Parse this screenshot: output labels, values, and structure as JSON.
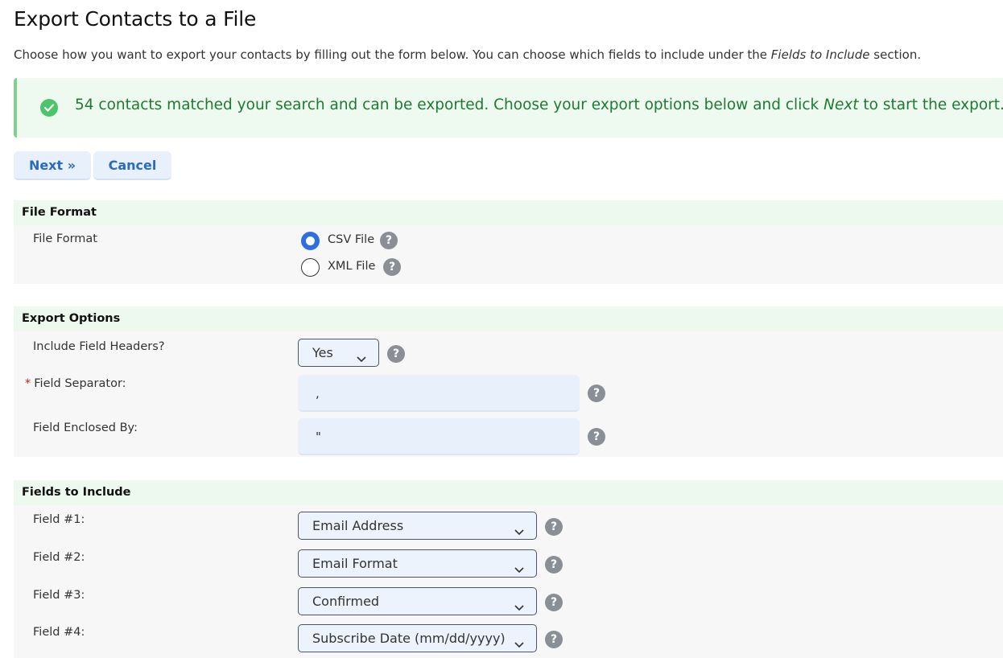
{
  "page": {
    "title": "Export Contacts to a File",
    "intro_text": "Choose how you want to export your contacts by filling out the form below. You can choose which fields to include under the ",
    "intro_emphasis": "Fields to Include",
    "intro_suffix": " section."
  },
  "alert": {
    "icon": "check-circle-icon",
    "text": "54 contacts matched your search and can be exported. Choose your export options below and click ",
    "emphasis": "Next",
    "suffix": " to start the export."
  },
  "buttons": {
    "next_label": "Next »",
    "cancel_label": "Cancel"
  },
  "file_format": {
    "section_title": "File Format",
    "label": "File Format",
    "options": [
      {
        "label": "CSV File",
        "checked": true
      },
      {
        "label": "XML File",
        "checked": false
      }
    ]
  },
  "export_options": {
    "section_title": "Export Options",
    "include_headers_label": "Include Field Headers?",
    "include_headers_value": "Yes",
    "required_marker": "*",
    "separator_label": "Field Separator:",
    "separator_value": ",",
    "enclosed_label": "Field Enclosed By:",
    "enclosed_value": "\""
  },
  "fields_to_include": {
    "section_title": "Fields to Include",
    "fields": [
      {
        "label": "Field #1:",
        "value": "Email Address"
      },
      {
        "label": "Field #2:",
        "value": "Email Format"
      },
      {
        "label": "Field #3:",
        "value": "Confirmed"
      },
      {
        "label": "Field #4:",
        "value": "Subscribe Date (mm/dd/yyyy)"
      }
    ]
  },
  "help_glyph": "?",
  "colors": {
    "accent": "#2f6ee0",
    "success_text": "#1e7a32",
    "success_bg": "#eef9ef",
    "section_header_bg": "#edf8ee"
  }
}
